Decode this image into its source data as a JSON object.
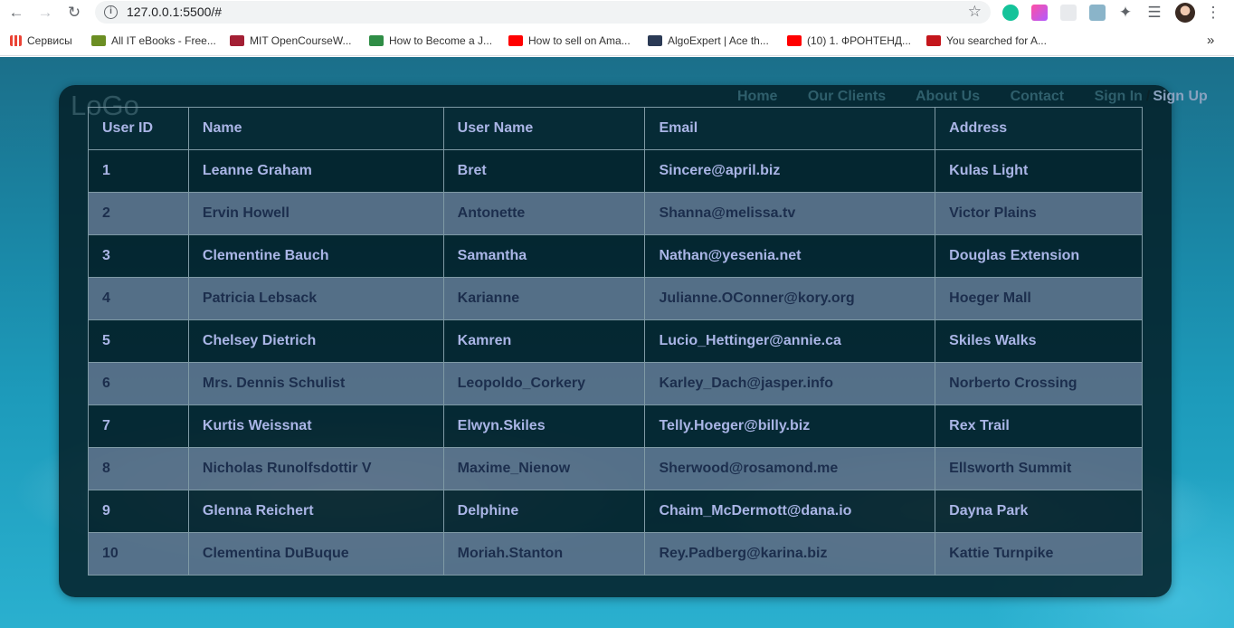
{
  "browser": {
    "url": "127.0.0.1:5500/#",
    "bookmarks": [
      {
        "label": "Сервисы",
        "color": "#4285f4"
      },
      {
        "label": "All IT eBooks - Free...",
        "color": "#6b8e23"
      },
      {
        "label": "MIT OpenCourseW...",
        "color": "#a31f34"
      },
      {
        "label": "How to Become a J...",
        "color": "#2f8d46"
      },
      {
        "label": "How to sell on Ama...",
        "color": "#ff0000"
      },
      {
        "label": "AlgoExpert | Ace th...",
        "color": "#2b3a55"
      },
      {
        "label": "(10) 1. ФРОНТЕНД...",
        "color": "#ff0000"
      },
      {
        "label": "You searched for A...",
        "color": "#c4161c"
      }
    ],
    "more_label": "»"
  },
  "site": {
    "logo": "LoGo",
    "nav": [
      "Home",
      "Our Clients",
      "About Us",
      "Contact"
    ],
    "sign_in": "Sign In",
    "separator": "/",
    "sign_up": "Sign Up"
  },
  "table": {
    "headers": [
      "User ID",
      "Name",
      "User Name",
      "Email",
      "Address"
    ],
    "rows": [
      [
        "1",
        "Leanne Graham",
        "Bret",
        "Sincere@april.biz",
        "Kulas Light"
      ],
      [
        "2",
        "Ervin Howell",
        "Antonette",
        "Shanna@melissa.tv",
        "Victor Plains"
      ],
      [
        "3",
        "Clementine Bauch",
        "Samantha",
        "Nathan@yesenia.net",
        "Douglas Extension"
      ],
      [
        "4",
        "Patricia Lebsack",
        "Karianne",
        "Julianne.OConner@kory.org",
        "Hoeger Mall"
      ],
      [
        "5",
        "Chelsey Dietrich",
        "Kamren",
        "Lucio_Hettinger@annie.ca",
        "Skiles Walks"
      ],
      [
        "6",
        "Mrs. Dennis Schulist",
        "Leopoldo_Corkery",
        "Karley_Dach@jasper.info",
        "Norberto Crossing"
      ],
      [
        "7",
        "Kurtis Weissnat",
        "Elwyn.Skiles",
        "Telly.Hoeger@billy.biz",
        "Rex Trail"
      ],
      [
        "8",
        "Nicholas Runolfsdottir V",
        "Maxime_Nienow",
        "Sherwood@rosamond.me",
        "Ellsworth Summit"
      ],
      [
        "9",
        "Glenna Reichert",
        "Delphine",
        "Chaim_McDermott@dana.io",
        "Dayna Park"
      ],
      [
        "10",
        "Clementina DuBuque",
        "Moriah.Stanton",
        "Rey.Padberg@karina.biz",
        "Kattie Turnpike"
      ]
    ]
  },
  "icons": {
    "back": "back-arrow-icon",
    "forward": "forward-arrow-icon",
    "reload": "reload-icon",
    "info": "site-info-icon",
    "star": "bookmark-star-icon",
    "extensions": "puzzle-icon",
    "menu": "kebab-menu-icon"
  }
}
